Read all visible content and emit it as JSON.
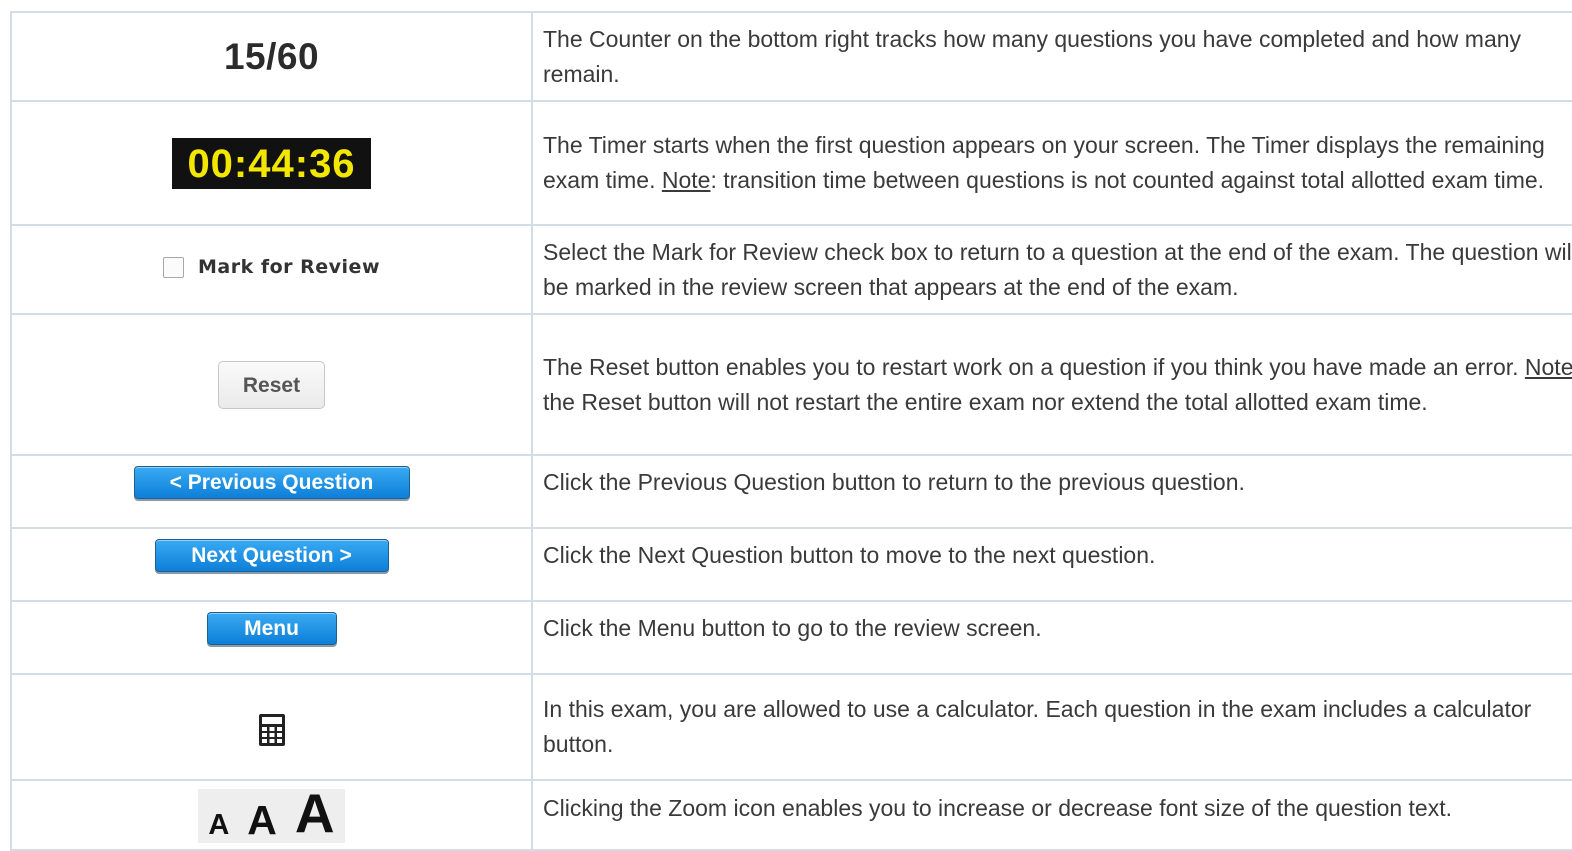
{
  "rows": [
    {
      "widget": "15/60",
      "text_a": "The Counter on the bottom right tracks how many questions you have completed and how many remain."
    },
    {
      "widget": "00:44:36",
      "text_a": "The Timer starts when the first question appears on your screen. The Timer displays the remaining exam time. ",
      "note": "Note",
      "text_b": ": transition time between questions is not counted against total allotted exam time."
    },
    {
      "widget": "Mark for Review",
      "text_a": "Select the Mark for Review check box to return to a question at the end of the exam. The question will be marked in the review screen that appears at the end of the exam."
    },
    {
      "widget": "Reset",
      "text_a": "The Reset button enables you to restart work on a question if you think you have made an error. ",
      "note": "Note",
      "text_b": ": the Reset button will not restart the entire exam nor extend the total allotted exam time."
    },
    {
      "widget": "< Previous Question",
      "text_a": "Click the Previous Question button to return to the previous question."
    },
    {
      "widget": "Next Question >",
      "text_a": "Click the Next Question button to move to the next question."
    },
    {
      "widget": "Menu",
      "text_a": "Click the Menu button to go to the review screen."
    },
    {
      "widget": "calculator-icon",
      "text_a": "In this exam, you are allowed to use a calculator. Each question in the exam includes a calculator button."
    },
    {
      "widget": [
        "A",
        "A",
        "A"
      ],
      "text_a": "Clicking the Zoom icon enables you to increase or decrease font size of the question text."
    }
  ],
  "colors": {
    "border": "#d3dde7",
    "timer_bg": "#111111",
    "timer_fg": "#f3e700",
    "button_blue": "#0d7fd8"
  }
}
